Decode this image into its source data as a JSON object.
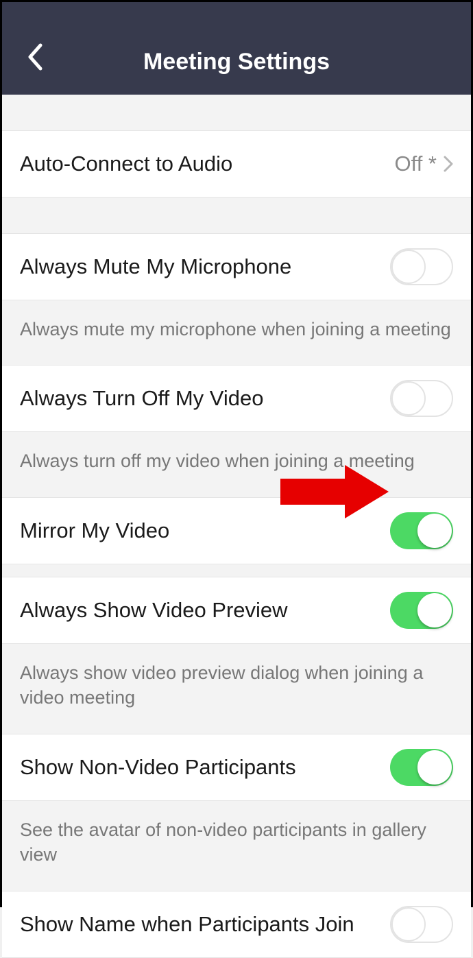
{
  "header": {
    "title": "Meeting Settings"
  },
  "rows": {
    "autoConnect": {
      "label": "Auto-Connect to Audio",
      "value": "Off *"
    },
    "muteMic": {
      "label": "Always Mute My Microphone",
      "desc": "Always mute my microphone when joining a meeting",
      "on": false
    },
    "turnOffVideo": {
      "label": "Always Turn Off My Video",
      "desc": "Always turn off my video when joining a meeting",
      "on": false
    },
    "mirrorVideo": {
      "label": "Mirror My Video",
      "on": true
    },
    "videoPreview": {
      "label": "Always Show Video Preview",
      "desc": "Always show video preview dialog when joining a video meeting",
      "on": true
    },
    "nonVideo": {
      "label": "Show Non-Video Participants",
      "desc": "See the avatar of non-video participants in gallery view",
      "on": true
    },
    "showName": {
      "label": "Show Name when Participants Join",
      "on": false
    }
  }
}
